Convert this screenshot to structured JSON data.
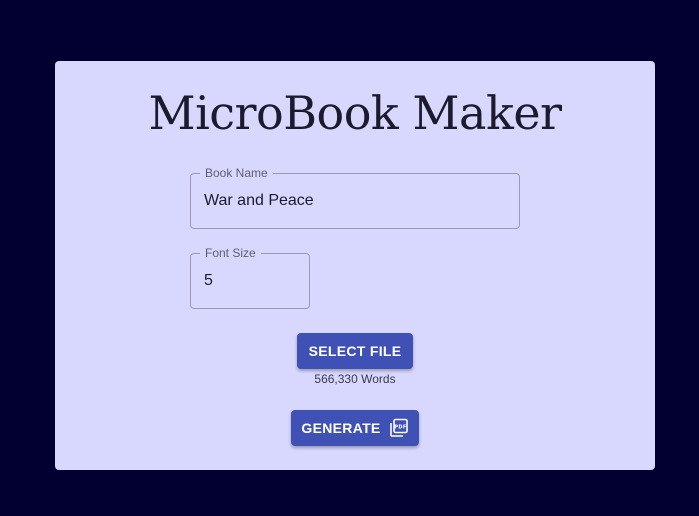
{
  "app": {
    "title": "MicroBook Maker"
  },
  "form": {
    "book_name": {
      "label": "Book Name",
      "value": "War and Peace"
    },
    "font_size": {
      "label": "Font Size",
      "value": "5"
    },
    "select_file_label": "SELECT FILE",
    "word_count_text": "566,330 Words",
    "generate_label": "GENERATE",
    "generate_icon": "pdf-icon"
  },
  "colors": {
    "page_background": "#020030",
    "card_background": "#d8d8ff",
    "button_primary": "#3f51b5"
  }
}
